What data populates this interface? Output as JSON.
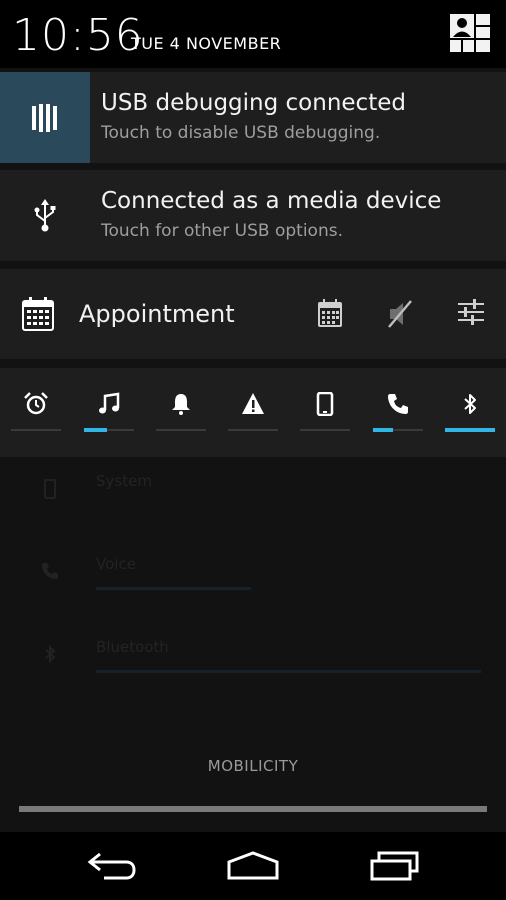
{
  "status_bar": {
    "time": "10:56",
    "date": "TUE 4 NOVEMBER",
    "user_icon": "user-switcher-icon"
  },
  "notifications": [
    {
      "title": "USB debugging connected",
      "subtitle": "Touch to disable USB debugging.",
      "icon": "android-debug-icon",
      "icon_bg": "#2a4a5c"
    },
    {
      "title": "Connected as a media device",
      "subtitle": "Touch for other USB options.",
      "icon": "usb-icon"
    }
  ],
  "profile": {
    "label": "Appointment",
    "icon": "calendar-icon",
    "actions": [
      "calendar-icon",
      "mute-icon",
      "settings-sliders-icon"
    ]
  },
  "volume_modes": [
    {
      "icon": "alarm-icon",
      "level": 0
    },
    {
      "icon": "music-icon",
      "level": 0.45
    },
    {
      "icon": "bell-icon",
      "level": 0
    },
    {
      "icon": "warning-icon",
      "level": 0
    },
    {
      "icon": "phone-device-icon",
      "level": 0
    },
    {
      "icon": "phone-call-icon",
      "level": 0.4
    },
    {
      "icon": "bluetooth-icon",
      "level": 1
    }
  ],
  "ghost_list": {
    "items": [
      {
        "label": "System",
        "icon": "phone-device-icon"
      },
      {
        "label": "Voice",
        "icon": "phone-call-icon"
      },
      {
        "label": "Bluetooth",
        "icon": "bluetooth-icon"
      }
    ]
  },
  "footer": {
    "brand": "MOBILICITY"
  },
  "nav_bar": {
    "back": "back-icon",
    "home": "home-icon",
    "recents": "recents-icon"
  },
  "colors": {
    "accent": "#33b5e5",
    "card_bg": "#1e1e1e",
    "shade_bg": "#121212"
  }
}
